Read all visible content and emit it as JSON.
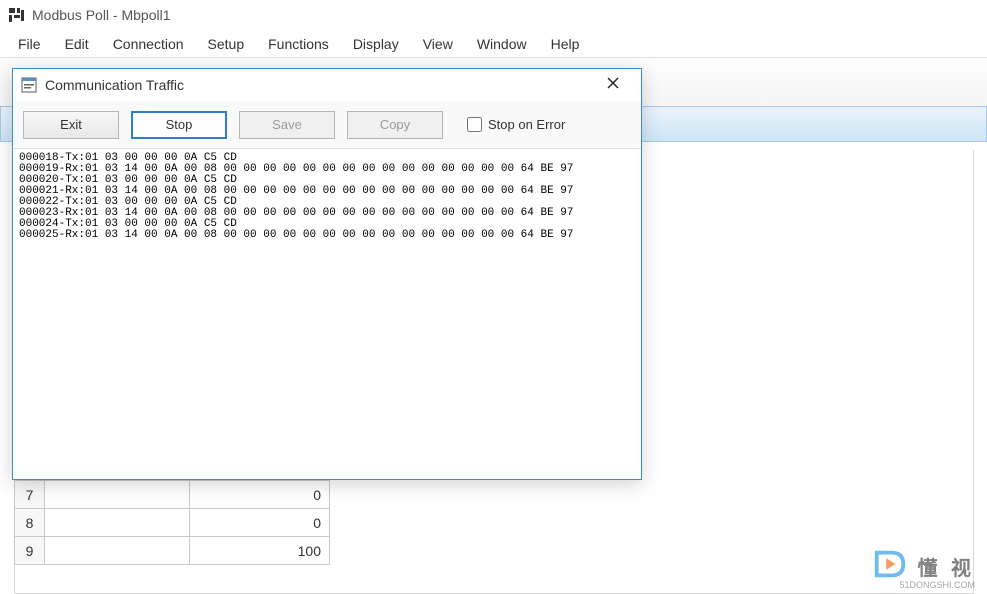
{
  "app": {
    "title": "Modbus Poll - Mbpoll1"
  },
  "menubar": {
    "items": [
      "File",
      "Edit",
      "Connection",
      "Setup",
      "Functions",
      "Display",
      "View",
      "Window",
      "Help"
    ]
  },
  "dialog": {
    "title": "Communication Traffic",
    "buttons": {
      "exit": "Exit",
      "stop": "Stop",
      "save": "Save",
      "copy": "Copy"
    },
    "stop_on_error_label": "Stop on Error",
    "stop_on_error_checked": false,
    "traffic_lines": [
      "000018-Tx:01 03 00 00 00 0A C5 CD",
      "000019-Rx:01 03 14 00 0A 00 08 00 00 00 00 00 00 00 00 00 00 00 00 00 00 00 64 BE 97",
      "000020-Tx:01 03 00 00 00 0A C5 CD",
      "000021-Rx:01 03 14 00 0A 00 08 00 00 00 00 00 00 00 00 00 00 00 00 00 00 00 64 BE 97",
      "000022-Tx:01 03 00 00 00 0A C5 CD",
      "000023-Rx:01 03 14 00 0A 00 08 00 00 00 00 00 00 00 00 00 00 00 00 00 00 00 64 BE 97",
      "000024-Tx:01 03 00 00 00 0A C5 CD",
      "000025-Rx:01 03 14 00 0A 00 08 00 00 00 00 00 00 00 00 00 00 00 00 00 00 00 64 BE 97"
    ]
  },
  "table_rows": [
    {
      "index": "7",
      "value": "0"
    },
    {
      "index": "8",
      "value": "0"
    },
    {
      "index": "9",
      "value": "100"
    }
  ],
  "watermark": {
    "text": "懂 视",
    "sub": "51DONGSHI.COM"
  }
}
